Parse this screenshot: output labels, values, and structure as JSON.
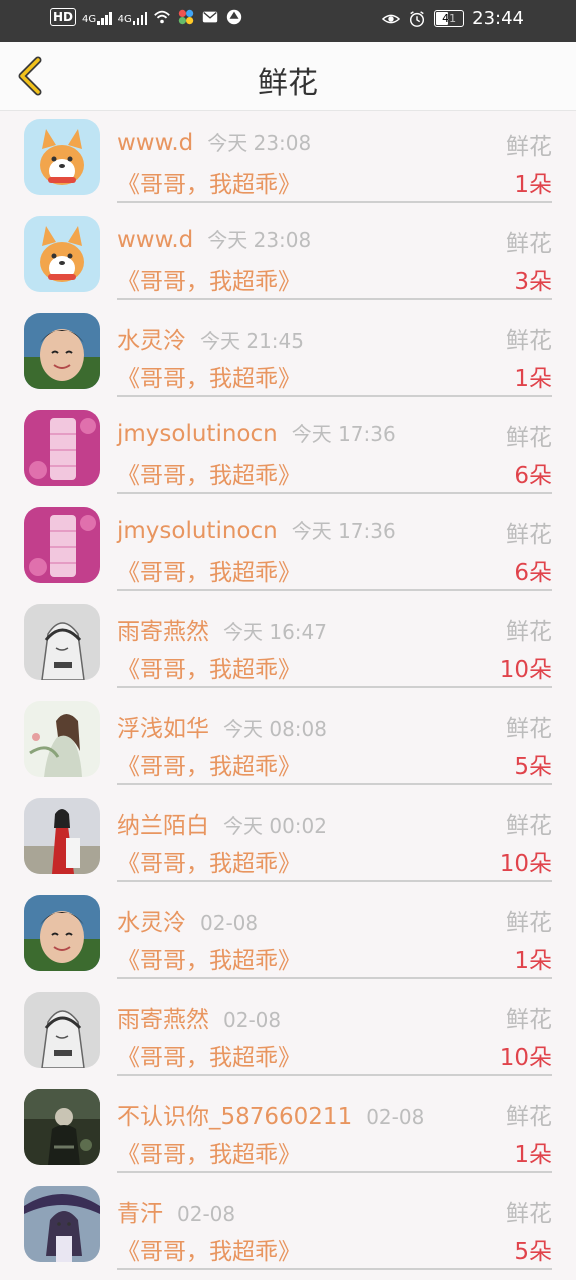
{
  "status_bar": {
    "hd": "HD",
    "net1": "4G",
    "net2": "4G",
    "battery": "41",
    "time": "23:44"
  },
  "header": {
    "title": "鲜花"
  },
  "records": [
    {
      "name": "www.d",
      "time": "今天 23:08",
      "label": "鲜花",
      "title": "《哥哥，我超乖》",
      "count": "1朵",
      "avatar": "corgi"
    },
    {
      "name": "www.d",
      "time": "今天 23:08",
      "label": "鲜花",
      "title": "《哥哥，我超乖》",
      "count": "3朵",
      "avatar": "corgi"
    },
    {
      "name": "水灵泠",
      "time": "今天 21:45",
      "label": "鲜花",
      "title": "《哥哥，我超乖》",
      "count": "1朵",
      "avatar": "child"
    },
    {
      "name": "jmysolutinocn",
      "time": "今天 17:36",
      "label": "鲜花",
      "title": "《哥哥，我超乖》",
      "count": "6朵",
      "avatar": "pink"
    },
    {
      "name": "jmysolutinocn",
      "time": "今天 17:36",
      "label": "鲜花",
      "title": "《哥哥，我超乖》",
      "count": "6朵",
      "avatar": "pink"
    },
    {
      "name": "雨寄燕然",
      "time": "今天 16:47",
      "label": "鲜花",
      "title": "《哥哥，我超乖》",
      "count": "10朵",
      "avatar": "sketch"
    },
    {
      "name": "浮浅如华",
      "time": "今天 08:08",
      "label": "鲜花",
      "title": "《哥哥，我超乖》",
      "count": "5朵",
      "avatar": "ancient"
    },
    {
      "name": "纳兰陌白",
      "time": "今天 00:02",
      "label": "鲜花",
      "title": "《哥哥，我超乖》",
      "count": "10朵",
      "avatar": "redrobe"
    },
    {
      "name": "水灵泠",
      "time": "02-08",
      "label": "鲜花",
      "title": "《哥哥，我超乖》",
      "count": "1朵",
      "avatar": "child"
    },
    {
      "name": "雨寄燕然",
      "time": "02-08",
      "label": "鲜花",
      "title": "《哥哥，我超乖》",
      "count": "10朵",
      "avatar": "sketch"
    },
    {
      "name": "不认识你_587660211",
      "time": "02-08",
      "label": "鲜花",
      "title": "《哥哥，我超乖》",
      "count": "1朵",
      "avatar": "dark"
    },
    {
      "name": "青汗",
      "time": "02-08",
      "label": "鲜花",
      "title": "《哥哥，我超乖》",
      "count": "5朵",
      "avatar": "anime"
    }
  ]
}
